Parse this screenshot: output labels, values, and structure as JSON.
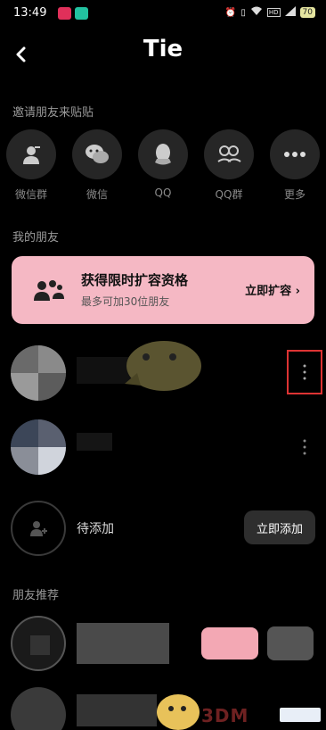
{
  "status_bar": {
    "time": "13:49",
    "icons": [
      "alarm-icon",
      "vibrate-icon",
      "wifi-icon",
      "hd-icon",
      "signal-icon"
    ],
    "battery": "70"
  },
  "header": {
    "title": "Tie",
    "back_icon": "chevron-left-icon"
  },
  "invite_section": {
    "label": "邀请朋友来贴贴",
    "items": [
      {
        "label": "微信群",
        "icon": "wechat-group-icon"
      },
      {
        "label": "微信",
        "icon": "wechat-icon"
      },
      {
        "label": "QQ",
        "icon": "qq-icon"
      },
      {
        "label": "QQ群",
        "icon": "qq-group-icon"
      },
      {
        "label": "更多",
        "icon": "more-dots-icon"
      }
    ]
  },
  "friends_section": {
    "label": "我的朋友",
    "promo": {
      "title": "获得限时扩容资格",
      "subtitle": "最多可加30位朋友",
      "action": "立即扩容"
    },
    "pending": {
      "label": "待添加",
      "button": "立即添加"
    }
  },
  "recommend_section": {
    "label": "朋友推荐"
  },
  "watermark": "3DM",
  "colors": {
    "background": "#000000",
    "promo_bg": "#f5b8c4",
    "highlight": "#dd3333"
  }
}
